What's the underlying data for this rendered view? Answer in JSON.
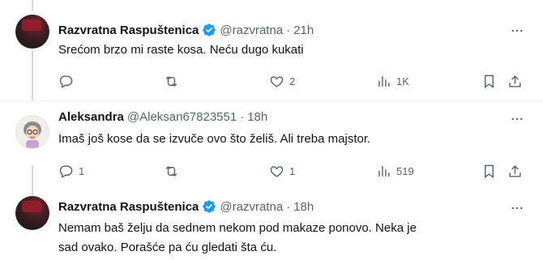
{
  "tweets": [
    {
      "name": "Razvratna Raspuštenica",
      "handle": "@razvratna",
      "separator": "·",
      "time": "21h",
      "text": "Srećom brzo mi raste kosa. Neću dugo kukati",
      "replies": "",
      "retweets": "",
      "likes": "2",
      "views": "1K",
      "verified": true,
      "avatar": "dark-red-avatar"
    },
    {
      "name": "Aleksandra",
      "handle": "@Aleksan67823551",
      "separator": "·",
      "time": "18h",
      "text": "Imaš još kose da se izvuče ovo što želiš. Ali treba majstor.",
      "replies": "1",
      "retweets": "",
      "likes": "1",
      "views": "519",
      "verified": false,
      "avatar": "cartoon-avatar"
    },
    {
      "name": "Razvratna Raspuštenica",
      "handle": "@razvratna",
      "separator": "·",
      "time": "18h",
      "text": "Nemam baš želju da sednem nekom pod makaze ponovo. Neka je sad ovako. Porašće pa ću gledati šta ću.",
      "verified": true,
      "avatar": "dark-red-avatar"
    }
  ],
  "colors": {
    "verified": "#1d9bf0",
    "muted": "#536471",
    "text": "#0f1419",
    "divider": "#eff3f4"
  },
  "icons": [
    "reply-icon",
    "retweet-icon",
    "like-icon",
    "views-icon",
    "bookmark-icon",
    "share-icon",
    "more-icon",
    "verified-badge-icon"
  ]
}
